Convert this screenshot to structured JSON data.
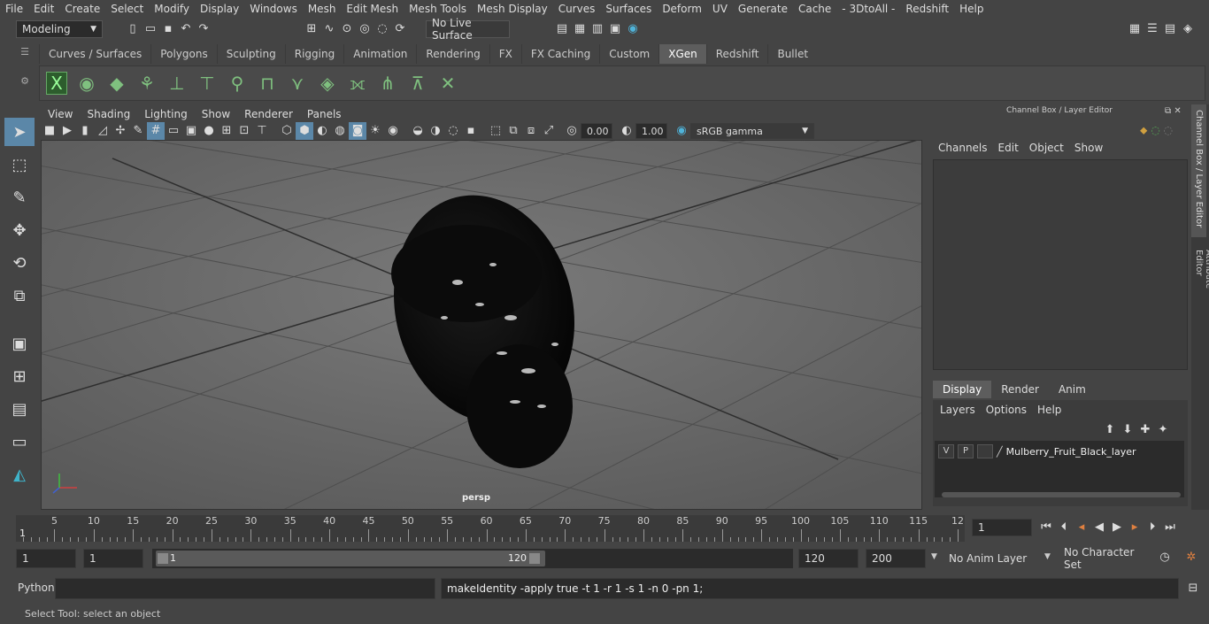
{
  "menubar": [
    "File",
    "Edit",
    "Create",
    "Select",
    "Modify",
    "Display",
    "Windows",
    "Mesh",
    "Edit Mesh",
    "Mesh Tools",
    "Mesh Display",
    "Curves",
    "Surfaces",
    "Deform",
    "UV",
    "Generate",
    "Cache",
    "- 3DtoAll -",
    "Redshift",
    "Help"
  ],
  "toolbar": {
    "mode": "Modeling",
    "live_surface": "No Live Surface"
  },
  "shelf_tabs": [
    "Curves / Surfaces",
    "Polygons",
    "Sculpting",
    "Rigging",
    "Animation",
    "Rendering",
    "FX",
    "FX Caching",
    "Custom",
    "XGen",
    "Redshift",
    "Bullet"
  ],
  "shelf_active": "XGen",
  "viewport": {
    "menu": [
      "View",
      "Shading",
      "Lighting",
      "Show",
      "Renderer",
      "Panels"
    ],
    "exposure": "0.00",
    "gamma": "1.00",
    "colorspace": "sRGB gamma",
    "camera_label": "persp"
  },
  "channel_box": {
    "title": "Channel Box / Layer Editor",
    "menu": [
      "Channels",
      "Edit",
      "Object",
      "Show"
    ],
    "layer_tabs": [
      "Display",
      "Render",
      "Anim"
    ],
    "layer_menu": [
      "Layers",
      "Options",
      "Help"
    ],
    "layer": {
      "v": "V",
      "p": "P",
      "name": "Mulberry_Fruit_Black_layer"
    },
    "side_tabs": [
      "Channel Box / Layer Editor",
      "Attribute Editor"
    ]
  },
  "timeline": {
    "ticks": [
      "5",
      "10",
      "15",
      "20",
      "25",
      "30",
      "35",
      "40",
      "45",
      "50",
      "55",
      "60",
      "65",
      "70",
      "75",
      "80",
      "85",
      "90",
      "95",
      "100",
      "105",
      "110",
      "115",
      "12"
    ],
    "start_mark": "1",
    "current_frame": "1"
  },
  "range": {
    "start": "1",
    "playback_start": "1",
    "slider_start": "1",
    "slider_end": "120",
    "playback_end": "120",
    "end": "200",
    "anim_layer": "No Anim Layer",
    "character_set": "No Character Set"
  },
  "command": {
    "language": "Python",
    "output": "makeIdentity -apply true -t 1 -r 1 -s 1 -n 0 -pn 1;"
  },
  "help_line": "Select Tool: select an object"
}
